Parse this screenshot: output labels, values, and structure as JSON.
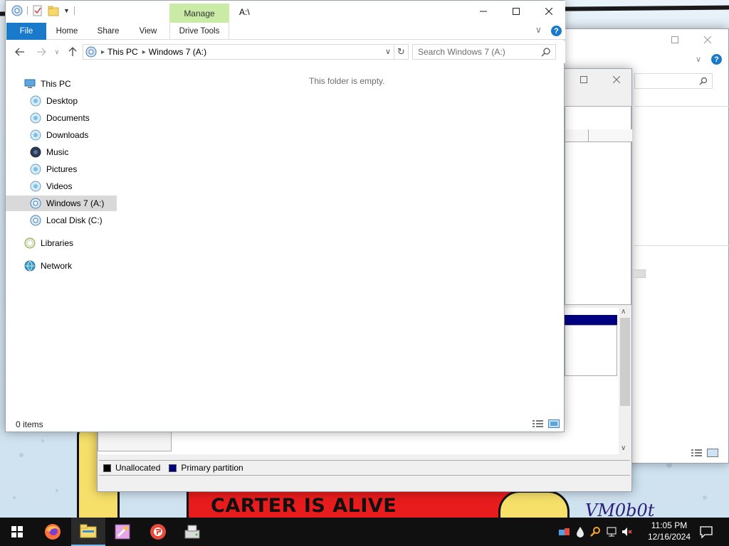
{
  "desktop": {
    "banner_text": "CARTER IS ALIVE",
    "corner_text": "VM0b0t"
  },
  "explorer": {
    "title": "A:\\",
    "ribbon": {
      "manage_label": "Manage",
      "tabs": [
        "File",
        "Home",
        "Share",
        "View",
        "Drive Tools"
      ],
      "help_label": "?"
    },
    "address": {
      "crumbs": [
        "This PC",
        "Windows 7 (A:)"
      ]
    },
    "search": {
      "placeholder": "Search Windows 7 (A:)"
    },
    "nav_pane": {
      "this_pc": "This PC",
      "items": [
        "Desktop",
        "Documents",
        "Downloads",
        "Music",
        "Pictures",
        "Videos",
        "Windows 7 (A:)",
        "Local Disk (C:)"
      ],
      "selected": "Windows 7 (A:)",
      "libraries": "Libraries",
      "network": "Network"
    },
    "content": {
      "empty_message": "This folder is empty."
    },
    "status": {
      "item_count": "0 items"
    }
  },
  "disk_mgmt": {
    "legend": [
      {
        "label": "Unallocated",
        "color": "#000000"
      },
      {
        "label": "Primary partition",
        "color": "#000080"
      }
    ]
  },
  "taskbar": {
    "apps": [
      "start-icon",
      "firefox-icon",
      "file-explorer-icon",
      "paint-icon",
      "pdf-reader-icon",
      "drive-tool-icon"
    ],
    "active_app": "file-explorer-icon",
    "clock_time": "11:05 PM",
    "clock_date": "12/16/2024"
  },
  "colors": {
    "accent": "#1979ca",
    "manage_tab": "#c9eba6",
    "taskbar": "#101010",
    "selected_nav": "#d9d9d9"
  }
}
